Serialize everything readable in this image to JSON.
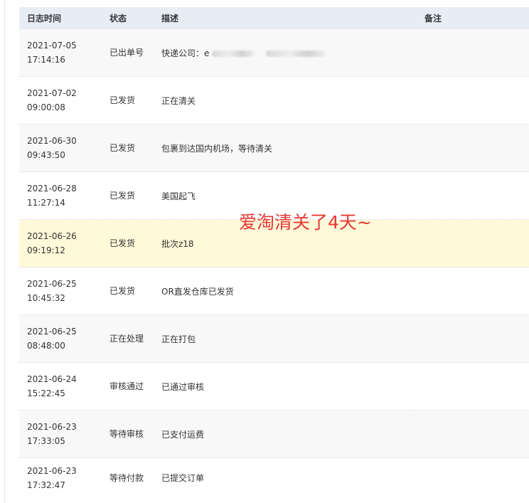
{
  "table": {
    "headers": {
      "time": "日志时间",
      "status": "状态",
      "desc": "描述",
      "note": "备注"
    },
    "rows": [
      {
        "date": "2021-07-05",
        "time": "17:14:16",
        "status": "已出单号",
        "desc": "快递公司：e"
      },
      {
        "date": "2021-07-02",
        "time": "09:00:08",
        "status": "已发货",
        "desc": "正在清关"
      },
      {
        "date": "2021-06-30",
        "time": "09:43:50",
        "status": "已发货",
        "desc": "包裹到达国内机场，等待清关"
      },
      {
        "date": "2021-06-28",
        "time": "11:27:14",
        "status": "已发货",
        "desc": "美国起飞"
      },
      {
        "date": "2021-06-26",
        "time": "09:19:12",
        "status": "已发货",
        "desc": "批次z18"
      },
      {
        "date": "2021-06-25",
        "time": "10:45:32",
        "status": "已发货",
        "desc": "OR直发仓库已发货"
      },
      {
        "date": "2021-06-25",
        "time": "08:48:00",
        "status": "正在处理",
        "desc": "正在打包"
      },
      {
        "date": "2021-06-24",
        "time": "15:22:45",
        "status": "审核通过",
        "desc": "已通过审核"
      },
      {
        "date": "2021-06-23",
        "time": "17:33:05",
        "status": "等待审核",
        "desc": "已支付运费"
      },
      {
        "date": "2021-06-23",
        "time": "17:32:47",
        "status": "等待付款",
        "desc": "已提交订单"
      }
    ]
  },
  "annotation": "爱淘清关了4天~",
  "colors": {
    "header_bg": "#e8edf5",
    "row_alt_bg": "#f8f8f8",
    "highlight_bg": "#fff9d9",
    "annotation": "#e53935"
  }
}
